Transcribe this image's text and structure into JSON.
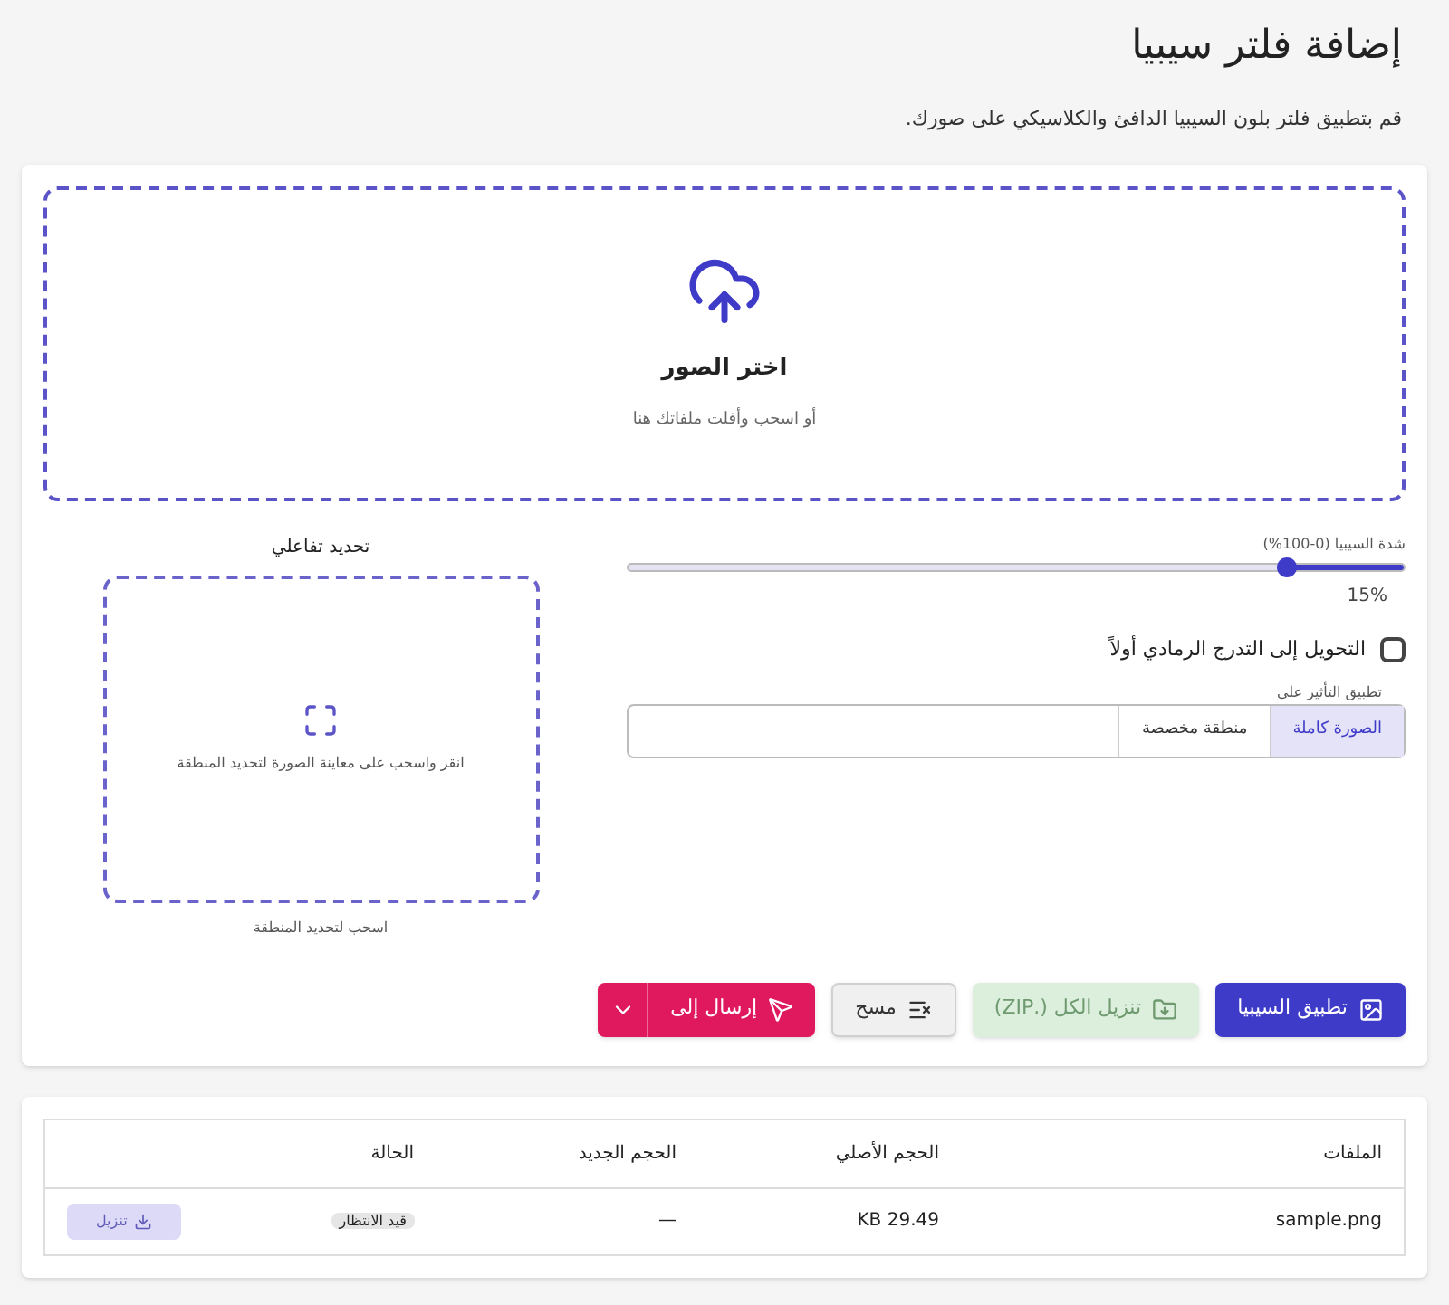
{
  "title": "إضافة فلتر سيبيا",
  "description": "قم بتطبيق فلتر بلون السيبيا الدافئ والكلاسيكي على صورك.",
  "upload": {
    "title": "اختر الصور",
    "hint": "أو اسحب وأفلت ملفاتك هنا"
  },
  "slider": {
    "label": "شدة السيبيا (0-100%)",
    "level": 0.15,
    "reading": "15%"
  },
  "checkbox": {
    "label": "التحويل إلى التدرج الرمادي أولاً",
    "checked": false
  },
  "apply_to": {
    "legend": "تطبيق التأثير على",
    "options": [
      {
        "label": "الصورة كاملة",
        "selected": true
      },
      {
        "label": "منطقة مخصصة",
        "selected": false
      }
    ]
  },
  "crop": {
    "title": "تحديد تفاعلي",
    "hint": "انقر واسحب على معاينة الصورة لتحديد المنطقة",
    "caption": "اسحب لتحديد المنطقة"
  },
  "buttons": [
    {
      "kind": "primary",
      "label": "تطبيق السيبيا",
      "disabled": false
    },
    {
      "kind": "download",
      "label": "تنزيل الكل (.ZIP)",
      "disabled": true
    },
    {
      "kind": "clear",
      "label": "مسح",
      "disabled": false
    },
    {
      "kind": "send",
      "label": "إرسال إلى",
      "disabled": false
    }
  ],
  "table": {
    "columns": [
      "الملفات",
      "الحجم الأصلي",
      "الحجم الجديد",
      "الحالة"
    ],
    "rows": [
      {
        "file": "sample.png",
        "original": "29.49 KB",
        "new": "—",
        "status": "قيد الانتظار",
        "action": "تنزيل",
        "action_disabled": true
      }
    ]
  }
}
